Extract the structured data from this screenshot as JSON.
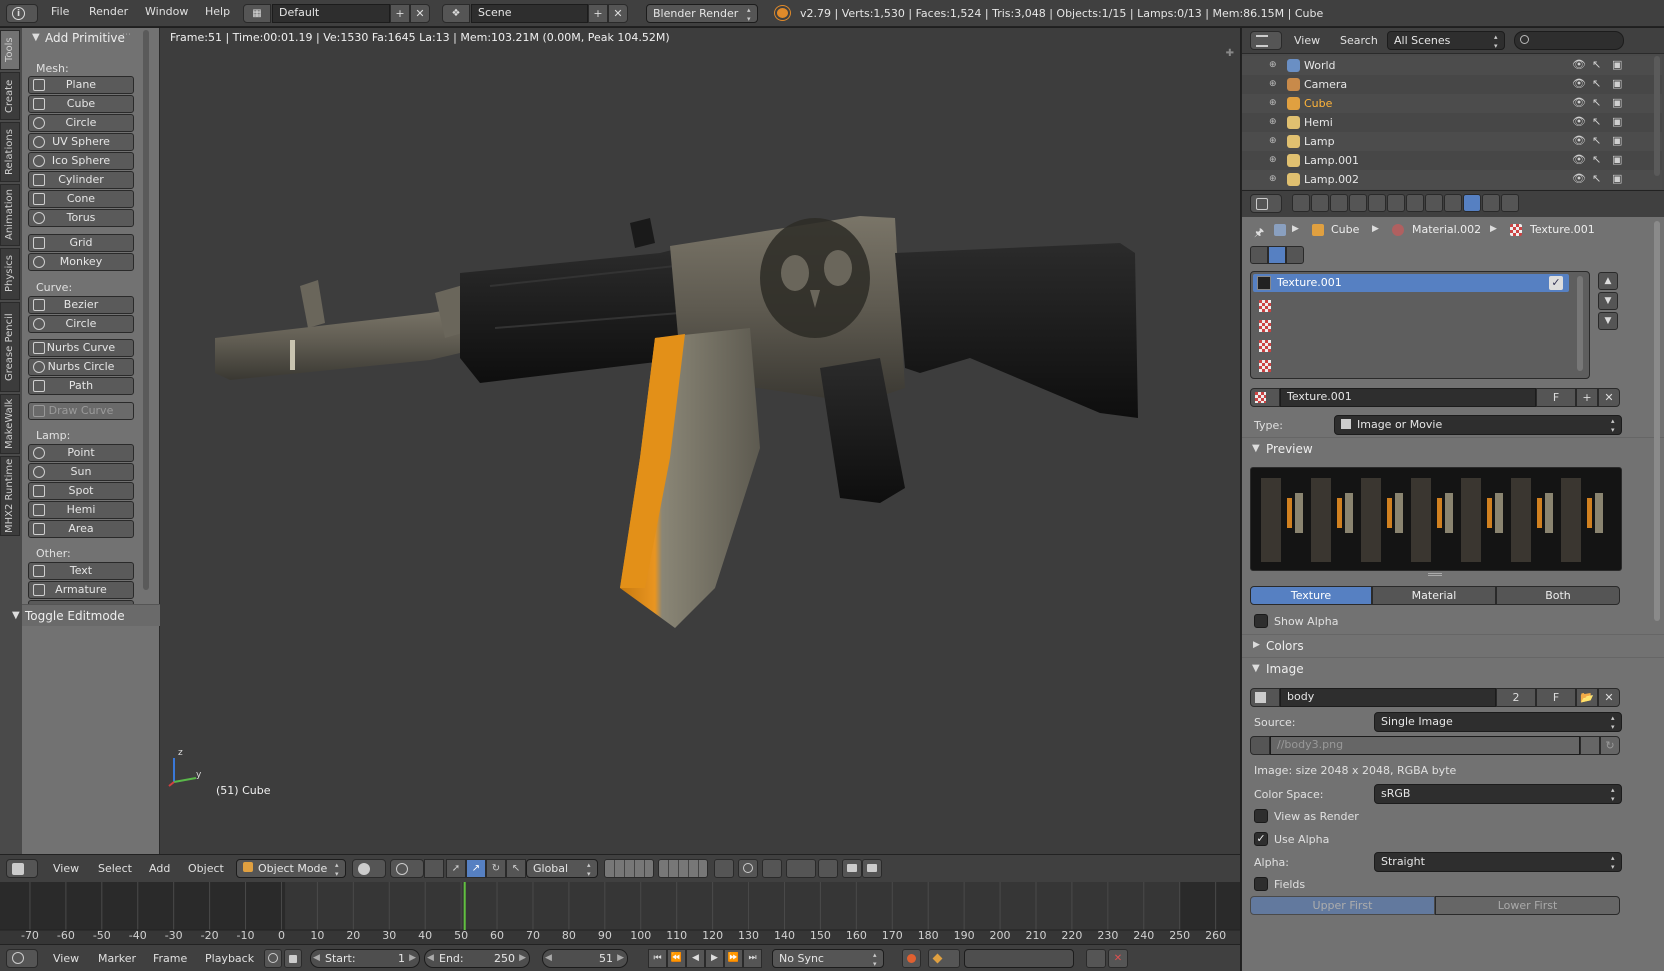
{
  "top_menu": {
    "items": [
      "File",
      "Render",
      "Window",
      "Help"
    ],
    "layout": "Default",
    "scene": "Scene",
    "engine": "Blender Render",
    "stats": "v2.79 | Verts:1,530 | Faces:1,524 | Tris:3,048 | Objects:1/15 | Lamps:0/13 | Mem:86.15M | Cube"
  },
  "tool_shelf": {
    "vertical_tabs": [
      "Tools",
      "Create",
      "Relations",
      "Animation",
      "Physics",
      "Grease Pencil",
      "MakeWalk",
      "MHX2 Runtime"
    ],
    "panel_title": "Add Primitive",
    "mesh_label": "Mesh:",
    "mesh_items": [
      "Plane",
      "Cube",
      "Circle",
      "UV Sphere",
      "Ico Sphere",
      "Cylinder",
      "Cone",
      "Torus"
    ],
    "mesh_extra": [
      "Grid",
      "Monkey"
    ],
    "curve_label": "Curve:",
    "curve_items": [
      "Bezier",
      "Circle"
    ],
    "nurbs_items": [
      "Nurbs Curve",
      "Nurbs Circle",
      "Path"
    ],
    "draw_curve": "Draw Curve",
    "lamp_label": "Lamp:",
    "lamp_items": [
      "Point",
      "Sun",
      "Spot",
      "Hemi",
      "Area"
    ],
    "other_label": "Other:",
    "other_items": [
      "Text",
      "Armature"
    ],
    "toggle_editmode": "Toggle Editmode"
  },
  "viewport": {
    "info": "Frame:51 | Time:00:01.19 | Ve:1530 Fa:1645 La:13 | Mem:103.21M (0.00M, Peak 104.52M)",
    "object_label": "(51) Cube",
    "axis_z": "z",
    "axis_y": "y"
  },
  "view3d_header": {
    "menus": [
      "View",
      "Select",
      "Add",
      "Object"
    ],
    "mode": "Object Mode",
    "orientation": "Global"
  },
  "timeline": {
    "ticks": [
      "-70",
      "-60",
      "-50",
      "-40",
      "-30",
      "-20",
      "-10",
      "0",
      "10",
      "20",
      "30",
      "40",
      "50",
      "60",
      "70",
      "80",
      "90",
      "100",
      "110",
      "120",
      "130",
      "140",
      "150",
      "160",
      "170",
      "180",
      "190",
      "200",
      "210",
      "220",
      "230",
      "240",
      "250",
      "260"
    ],
    "current_frame_value": 51,
    "frame_range": [
      -75,
      264
    ],
    "menus": [
      "View",
      "Marker",
      "Frame",
      "Playback"
    ],
    "start_label": "Start:",
    "start_value": "1",
    "end_label": "End:",
    "end_value": "250",
    "current": "51",
    "sync": "No Sync"
  },
  "outliner": {
    "menus": [
      "View",
      "Search"
    ],
    "scenes": "All Scenes",
    "rows": [
      {
        "name": "World",
        "color": "#6a8fc4"
      },
      {
        "name": "Camera",
        "color": "#c88a4a"
      },
      {
        "name": "Cube",
        "color": "#e0a040"
      },
      {
        "name": "Hemi",
        "color": "#e0c070"
      },
      {
        "name": "Lamp",
        "color": "#e0c070"
      },
      {
        "name": "Lamp.001",
        "color": "#e0c070"
      },
      {
        "name": "Lamp.002",
        "color": "#e0c070"
      }
    ]
  },
  "properties": {
    "breadcrumb": [
      "Cube",
      "Material.002",
      "Texture.001"
    ],
    "texture_slot": "Texture.001",
    "texture_name": "Texture.001",
    "texture_users": "F",
    "type_label": "Type:",
    "type_value": "Image or Movie",
    "preview_label": "Preview",
    "preview_tabs": [
      "Texture",
      "Material",
      "Both"
    ],
    "show_alpha": "Show Alpha",
    "colors_label": "Colors",
    "image_label": "Image",
    "image_name": "body",
    "image_users": "2",
    "image_fake": "F",
    "source_label": "Source:",
    "source_value": "Single Image",
    "filepath": "//body3.png",
    "image_info": "Image: size 2048 x 2048, RGBA byte",
    "color_space_label": "Color Space:",
    "color_space_value": "sRGB",
    "view_as_render": "View as Render",
    "use_alpha": "Use Alpha",
    "alpha_label": "Alpha:",
    "alpha_value": "Straight",
    "fields": "Fields",
    "field_order": [
      "Upper First",
      "Lower First"
    ]
  },
  "colors": {
    "accent": "#5680c2",
    "viewport_bg": "#3d3d3d",
    "panel_bg": "#727272",
    "header_bg": "#3a3a3a"
  }
}
